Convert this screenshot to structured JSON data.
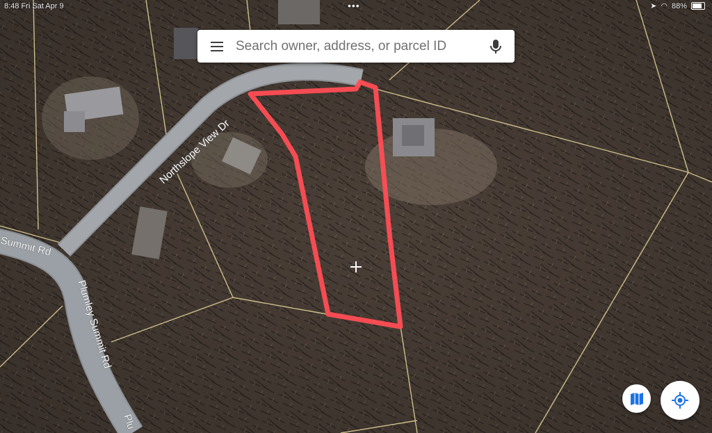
{
  "status_bar": {
    "time": "8:48 Fri Sat Apr 9",
    "dots": "•••",
    "battery_percent": "88%"
  },
  "search": {
    "placeholder": "Search owner, address, or parcel ID",
    "menu_icon": "hamburger-menu-icon",
    "mic_icon": "microphone-icon"
  },
  "map": {
    "view": "satellite",
    "roads": [
      {
        "name": "Northslope View Dr",
        "label": "Northslope View Dr"
      },
      {
        "name": "Plumley Summit Rd",
        "label": "Plumley Summit Rd"
      },
      {
        "name": "Summit Rd (west)",
        "label": "Summit Rd"
      },
      {
        "name": "Plumley Summit Rd (bottom)",
        "label": "Plu"
      }
    ],
    "selected_parcel_outline_color": "#ff4d55",
    "parcel_line_color": "#e6d79a",
    "center_crosshair": "crosshair-icon"
  },
  "controls": {
    "layers_button_icon": "map-layers-icon",
    "locate_button_icon": "my-location-icon",
    "accent": "#1a73e8"
  }
}
